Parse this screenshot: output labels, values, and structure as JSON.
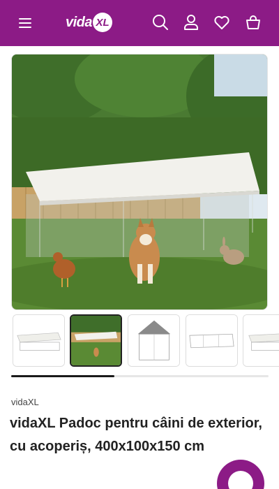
{
  "header": {
    "logo_text": "vida",
    "logo_badge": "XL",
    "icons": [
      "menu-icon",
      "search-icon",
      "user-icon",
      "heart-icon",
      "cart-icon"
    ],
    "background": "#8c1b86"
  },
  "gallery": {
    "thumbnail_count": 5,
    "active_index": 1,
    "scroll_progress": 0.4
  },
  "product": {
    "brand": "vidaXL",
    "title": "vidaXL Padoc pentru câini de exterior, cu acoperiș, 400x100x150 cm"
  },
  "colors": {
    "brand": "#8c1b86",
    "text": "#222222"
  }
}
